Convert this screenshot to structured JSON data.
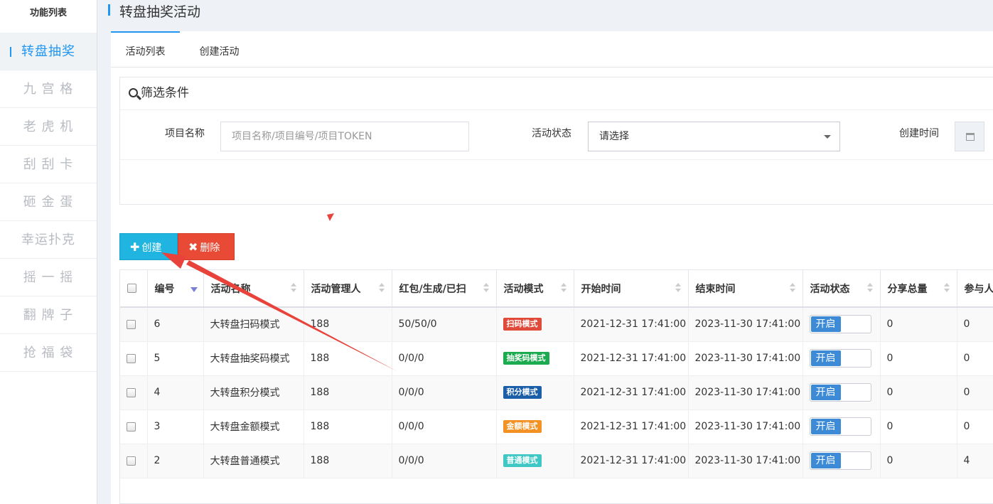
{
  "sidebar": {
    "title": "功能列表",
    "items": [
      {
        "label": "转盘抽奖",
        "active": true
      },
      {
        "label": "九 宫 格"
      },
      {
        "label": "老 虎 机"
      },
      {
        "label": "刮 刮 卡"
      },
      {
        "label": "砸 金 蛋"
      },
      {
        "label": "幸运扑克"
      },
      {
        "label": "摇 一 摇"
      },
      {
        "label": "翻 牌 子"
      },
      {
        "label": "抢 福 袋"
      }
    ]
  },
  "header": {
    "title": "转盘抽奖活动"
  },
  "tabs": [
    {
      "label": "活动列表",
      "active": true
    },
    {
      "label": "创建活动"
    }
  ],
  "filter": {
    "title": "筛选条件",
    "project_label": "项目名称",
    "project_placeholder": "项目名称/项目编号/项目TOKEN",
    "status_label": "活动状态",
    "status_value": "请选择",
    "time_label": "创建时间"
  },
  "actions": {
    "create": "创建",
    "delete": "删除"
  },
  "table": {
    "headers": [
      "编号",
      "活动名称",
      "活动管理人",
      "红包/生成/已扫",
      "活动模式",
      "开始时间",
      "结束时间",
      "活动状态",
      "分享总量",
      "参与人"
    ],
    "rows": [
      {
        "id": "6",
        "name": "大转盘扫码模式",
        "manager": "188",
        "redpack": "50/50/0",
        "mode": "扫码模式",
        "mode_color": "#e04a3a",
        "start": "2021-12-31 17:41:00",
        "end": "2023-11-30 17:41:00",
        "status": "开启",
        "share": "0",
        "join": "0"
      },
      {
        "id": "5",
        "name": "大转盘抽奖码模式",
        "manager": "188",
        "redpack": "0/0/0",
        "mode": "抽奖码模式",
        "mode_color": "#1aab4f",
        "start": "2021-12-31 17:41:00",
        "end": "2023-11-30 17:41:00",
        "status": "开启",
        "share": "0",
        "join": "0"
      },
      {
        "id": "4",
        "name": "大转盘积分模式",
        "manager": "188",
        "redpack": "0/0/0",
        "mode": "积分模式",
        "mode_color": "#1a5fa8",
        "start": "2021-12-31 17:41:00",
        "end": "2023-11-30 17:41:00",
        "status": "开启",
        "share": "0",
        "join": "0"
      },
      {
        "id": "3",
        "name": "大转盘金额模式",
        "manager": "188",
        "redpack": "0/0/0",
        "mode": "金额模式",
        "mode_color": "#f39222",
        "start": "2021-12-31 17:41:00",
        "end": "2023-11-30 17:41:00",
        "status": "开启",
        "share": "0",
        "join": "0"
      },
      {
        "id": "2",
        "name": "大转盘普通模式",
        "manager": "188",
        "redpack": "0/0/0",
        "mode": "普通模式",
        "mode_color": "#3fc7c6",
        "start": "2021-12-31 17:41:00",
        "end": "2023-11-30 17:41:00",
        "status": "开启",
        "share": "0",
        "join": "4"
      }
    ]
  },
  "colors": {
    "accent": "#2196f3",
    "create_btn": "#1fb5e0",
    "delete_btn": "#e84a36",
    "toggle_on": "#3d8bd6",
    "annotation": "#e8423a"
  }
}
